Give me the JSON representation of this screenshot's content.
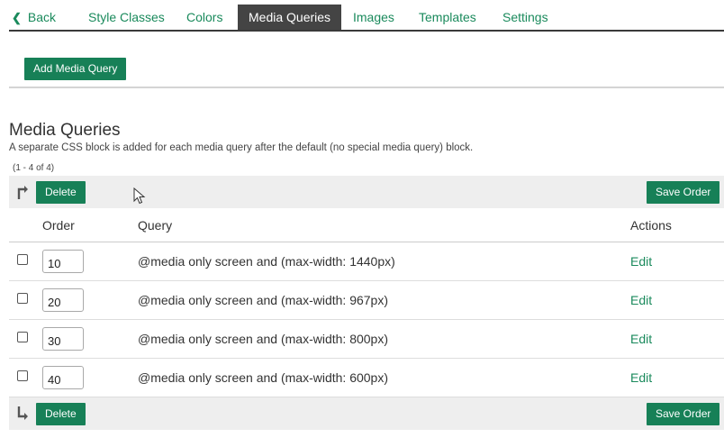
{
  "tabs": [
    {
      "label": "Back",
      "icon": "chevron-left-icon"
    },
    {
      "label": "Style Classes"
    },
    {
      "label": "Colors"
    },
    {
      "label": "Media Queries",
      "active": true
    },
    {
      "label": "Images"
    },
    {
      "label": "Templates"
    },
    {
      "label": "Settings"
    }
  ],
  "add_button_label": "Add Media Query",
  "section": {
    "title": "Media Queries",
    "description": "A separate CSS block is added for each media query after the default (no special media query) block.",
    "pager": "(1 - 4 of 4)"
  },
  "toolbar": {
    "delete_label": "Delete",
    "save_order_label": "Save Order"
  },
  "table": {
    "headers": {
      "order": "Order",
      "query": "Query",
      "actions": "Actions"
    },
    "rows": [
      {
        "order": "10",
        "query": "@media only screen and (max-width: 1440px)",
        "action": "Edit"
      },
      {
        "order": "20",
        "query": "@media only screen and (max-width: 967px)",
        "action": "Edit"
      },
      {
        "order": "30",
        "query": "@media only screen and (max-width: 800px)",
        "action": "Edit"
      },
      {
        "order": "40",
        "query": "@media only screen and (max-width: 600px)",
        "action": "Edit"
      }
    ]
  },
  "colors": {
    "accent": "#178057",
    "link": "#1a8a5c",
    "active_tab_bg": "#444444",
    "toolbar_bg": "#eeeeee"
  }
}
